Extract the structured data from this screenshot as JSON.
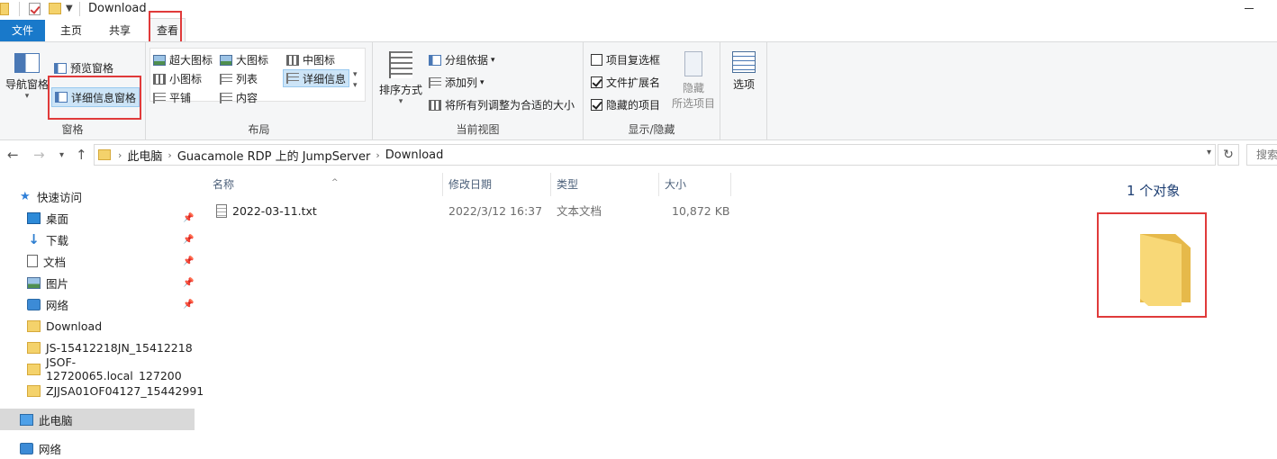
{
  "window": {
    "title": "Download"
  },
  "tabs": [
    {
      "label": "文件"
    },
    {
      "label": "主页"
    },
    {
      "label": "共享"
    },
    {
      "label": "查看"
    }
  ],
  "ribbon": {
    "pane_group": {
      "label": "窗格",
      "nav_pane": "导航窗格",
      "preview_pane": "预览窗格",
      "details_pane": "详细信息窗格"
    },
    "layout_group": {
      "label": "布局",
      "items": [
        "超大图标",
        "大图标",
        "中图标",
        "小图标",
        "列表",
        "详细信息",
        "平铺",
        "内容"
      ]
    },
    "current_view_group": {
      "label": "当前视图",
      "sort_by": "排序方式",
      "group_by": "分组依据",
      "add_columns": "添加列",
      "size_all_columns": "将所有列调整为合适的大小"
    },
    "show_hide_group": {
      "label": "显示/隐藏",
      "item_checkboxes": {
        "label": "项目复选框",
        "checked": false
      },
      "file_extensions": {
        "label": "文件扩展名",
        "checked": true
      },
      "hidden_items": {
        "label": "隐藏的项目",
        "checked": true
      },
      "hide_selected_line1": "隐藏",
      "hide_selected_line2": "所选项目"
    },
    "options": "选项"
  },
  "address_bar": {
    "crumbs": [
      "此电脑",
      "Guacamole RDP 上的 JumpServer",
      "Download"
    ],
    "search_placeholder": "搜索"
  },
  "sidebar": {
    "quick_access": "快速访问",
    "items": [
      {
        "label": "桌面",
        "icon": "desktop-icon",
        "pinned": true
      },
      {
        "label": "下载",
        "icon": "download-icon",
        "pinned": true
      },
      {
        "label": "文档",
        "icon": "document-icon",
        "pinned": true
      },
      {
        "label": "图片",
        "icon": "pictures-icon",
        "pinned": true
      },
      {
        "label": "网络",
        "icon": "network-icon",
        "pinned": true
      },
      {
        "label": "Download",
        "icon": "folder-icon",
        "pinned": false
      },
      {
        "label": "JS-15412218JN_15412218",
        "icon": "folder-icon",
        "pinned": false
      },
      {
        "label": "JSOF-12720065.local_127200",
        "icon": "folder-icon",
        "pinned": false
      },
      {
        "label": "ZJJSA01OF04127_15442991",
        "icon": "folder-icon",
        "pinned": false
      }
    ],
    "this_pc": "此电脑",
    "network": "网络"
  },
  "file_list": {
    "columns": [
      "名称",
      "修改日期",
      "类型",
      "大小"
    ],
    "rows": [
      {
        "name": "2022-03-11.txt",
        "modified": "2022/3/12 16:37",
        "type": "文本文档",
        "size": "10,872 KB"
      }
    ]
  },
  "details_pane": {
    "count": "1 个对象"
  },
  "colors": {
    "accent": "#1979ca",
    "highlight": "#e03a3a",
    "folder": "#f4d26b"
  }
}
